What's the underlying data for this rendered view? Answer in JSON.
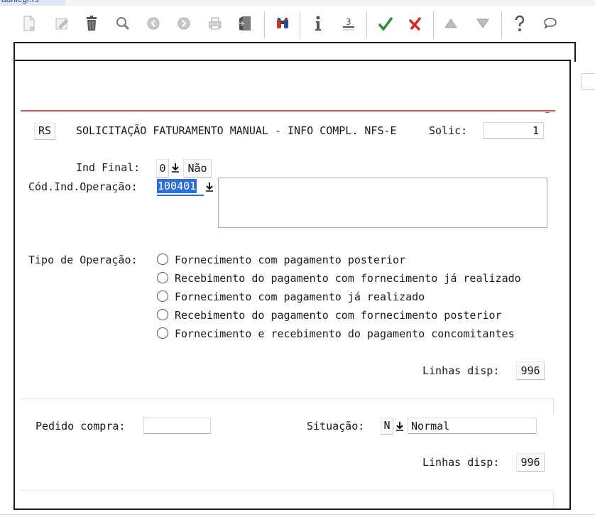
{
  "window": {
    "tab_title": "auniegr.rs"
  },
  "toolbar": {
    "buttons": [
      {
        "name": "new-document-icon"
      },
      {
        "name": "edit-icon"
      },
      {
        "name": "trash-icon"
      },
      {
        "name": "search-icon"
      },
      {
        "name": "previous-circle-icon"
      },
      {
        "name": "next-circle-icon"
      },
      {
        "name": "print-icon"
      },
      {
        "name": "exit-icon"
      },
      {
        "name": "binoculars-icon"
      },
      {
        "name": "info-icon"
      },
      {
        "name": "numbered-icon",
        "glyph": "3"
      },
      {
        "name": "confirm-check-icon"
      },
      {
        "name": "cancel-x-icon"
      },
      {
        "name": "arrow-up-icon"
      },
      {
        "name": "arrow-down-icon"
      },
      {
        "name": "help-icon",
        "glyph": "?"
      },
      {
        "name": "comment-icon"
      }
    ]
  },
  "header": {
    "code": "RS",
    "title": "SOLICITAÇÃO FATURAMENTO MANUAL - INFO COMPL. NFS-E",
    "solic_label": "Solic:",
    "solic_value": "1"
  },
  "ind_final": {
    "label": "Ind Final:",
    "value": "0",
    "description": "Não"
  },
  "cod_ind_operacao": {
    "label": "Cód.Ind.Operação:",
    "value": "100401",
    "description": ""
  },
  "tipo_operacao": {
    "label": "Tipo de Operação:",
    "options": [
      "Fornecimento com pagamento posterior",
      "Recebimento do pagamento com fornecimento já realizado",
      "Fornecimento com pagamento já realizado",
      "Recebimento do pagamento com fornecimento posterior",
      "Fornecimento e recebimento do pagamento concomitantes"
    ]
  },
  "upper_linhas_disp": {
    "label": "Linhas disp:",
    "value": "996"
  },
  "lower": {
    "pedido_compra_label": "Pedido compra:",
    "pedido_compra_value": "",
    "situacao_label": "Situação:",
    "situacao_code": "N",
    "situacao_desc": "Normal",
    "linhas_disp_label": "Linhas disp:",
    "linhas_disp_value": "996"
  }
}
